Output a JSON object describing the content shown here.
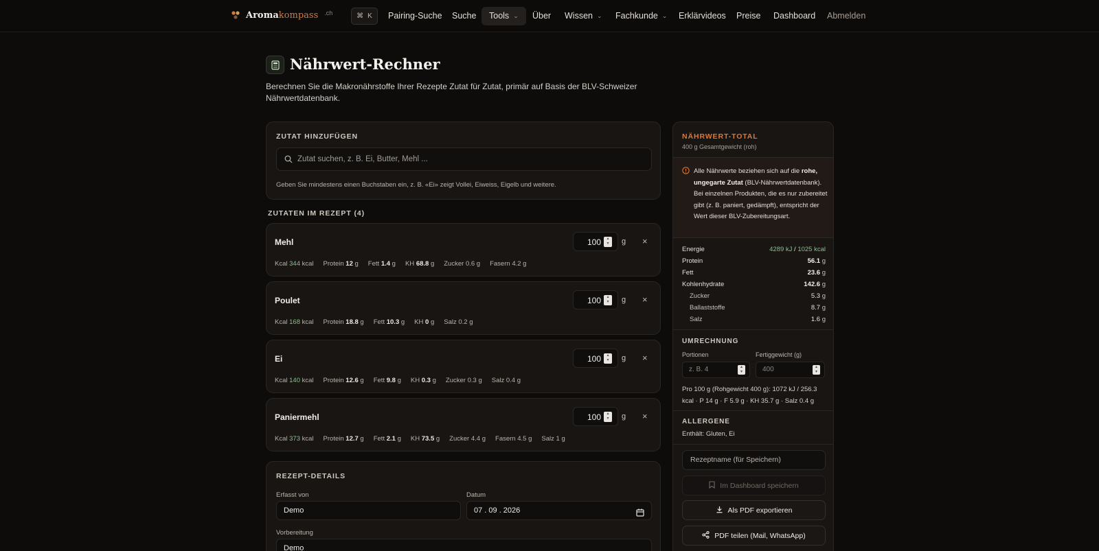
{
  "nav": {
    "logo_main": "Aroma",
    "logo_accent": "kompass",
    "logo_suffix": ".ch",
    "cmd_key": "⌘",
    "cmd_letter": "K",
    "items": [
      {
        "label": "Pairing-Suche"
      },
      {
        "label": "Suche"
      },
      {
        "label": "Tools",
        "active": true
      },
      {
        "label": "Über"
      },
      {
        "label": "Wissen"
      },
      {
        "label": "Fachkunde"
      },
      {
        "label": "Erklärvideos"
      },
      {
        "label": "Preise"
      },
      {
        "label": "Dashboard"
      },
      {
        "label": "Abmelden"
      }
    ]
  },
  "page": {
    "title": "Nährwert-Rechner",
    "subtitle": "Berechnen Sie die Makronährstoffe Ihrer Rezepte Zutat für Zutat, primär auf Basis der BLV-Schweizer Nährwertdatenbank."
  },
  "add": {
    "label": "ZUTAT HINZUFÜGEN",
    "placeholder": "Zutat suchen, z. B. Ei, Butter, Mehl ...",
    "hint": "Geben Sie mindestens einen Buchstaben ein, z. B. «Ei» zeigt Vollei, Eiweiss, Eigelb und weitere."
  },
  "recipe": {
    "heading": "ZUTATEN IM REZEPT (4)",
    "unit": "g",
    "remove": "×",
    "ingredients": [
      {
        "name": "Mehl",
        "qty": "100",
        "macros": [
          {
            "k": "Kcal",
            "v": "344",
            "u": "kcal",
            "kcal": true
          },
          {
            "k": "Protein",
            "v": "12",
            "u": "g"
          },
          {
            "k": "Fett",
            "v": "1.4",
            "u": "g"
          },
          {
            "k": "KH",
            "v": "68.8",
            "u": "g"
          },
          {
            "k": "Zucker",
            "v": "0.6",
            "u": "g",
            "plain": true
          },
          {
            "k": "Fasern",
            "v": "4.2",
            "u": "g",
            "plain": true
          }
        ]
      },
      {
        "name": "Poulet",
        "qty": "100",
        "macros": [
          {
            "k": "Kcal",
            "v": "168",
            "u": "kcal",
            "kcal": true
          },
          {
            "k": "Protein",
            "v": "18.8",
            "u": "g"
          },
          {
            "k": "Fett",
            "v": "10.3",
            "u": "g"
          },
          {
            "k": "KH",
            "v": "0",
            "u": "g"
          },
          {
            "k": "Salz",
            "v": "0.2",
            "u": "g",
            "plain": true
          }
        ]
      },
      {
        "name": "Ei",
        "qty": "100",
        "macros": [
          {
            "k": "Kcal",
            "v": "140",
            "u": "kcal",
            "kcal": true
          },
          {
            "k": "Protein",
            "v": "12.6",
            "u": "g"
          },
          {
            "k": "Fett",
            "v": "9.8",
            "u": "g"
          },
          {
            "k": "KH",
            "v": "0.3",
            "u": "g"
          },
          {
            "k": "Zucker",
            "v": "0.3",
            "u": "g",
            "plain": true
          },
          {
            "k": "Salz",
            "v": "0.4",
            "u": "g",
            "plain": true
          }
        ]
      },
      {
        "name": "Paniermehl",
        "qty": "100",
        "macros": [
          {
            "k": "Kcal",
            "v": "373",
            "u": "kcal",
            "kcal": true
          },
          {
            "k": "Protein",
            "v": "12.7",
            "u": "g"
          },
          {
            "k": "Fett",
            "v": "2.1",
            "u": "g"
          },
          {
            "k": "KH",
            "v": "73.5",
            "u": "g"
          },
          {
            "k": "Zucker",
            "v": "4.4",
            "u": "g",
            "plain": true
          },
          {
            "k": "Fasern",
            "v": "4.5",
            "u": "g",
            "plain": true
          },
          {
            "k": "Salz",
            "v": "1",
            "u": "g",
            "plain": true
          }
        ]
      }
    ]
  },
  "details": {
    "label": "REZEPT-DETAILS",
    "author_label": "Erfasst von",
    "author": "Demo",
    "date_label": "Datum",
    "date": "07 . 09 . 2026",
    "prep_label": "Vorbereitung",
    "prep": "Demo"
  },
  "totals": {
    "title": "NÄHRWERT-TOTAL",
    "subtitle": "400 g Gesamtgewicht (roh)",
    "warning_pre": "Alle Nährwerte beziehen sich auf die ",
    "warning_bold": "rohe, ungegarte Zutat",
    "warning_post": " (BLV-Nährwertdatenbank). Bei einzelnen Produkten, die es nur zubereitet gibt (z. B. paniert, gedämpft), entspricht der Wert dieser BLV-Zubereitungsart.",
    "energy_label": "Energie",
    "energy_kj": "4289 kJ",
    "energy_sep": " / ",
    "energy_kcal": "1025 kcal",
    "rows": [
      {
        "label": "Protein",
        "value": "56.1",
        "unit": "g",
        "bold": true
      },
      {
        "label": "Fett",
        "value": "23.6",
        "unit": "g",
        "bold": true
      },
      {
        "label": "Kohlenhydrate",
        "value": "142.6",
        "unit": "g",
        "bold": true
      },
      {
        "label": "Zucker",
        "value": "5.3",
        "unit": "g",
        "sub": true
      },
      {
        "label": "Ballaststoffe",
        "value": "8.7",
        "unit": "g",
        "sub": true
      },
      {
        "label": "Salz",
        "value": "1.6",
        "unit": "g",
        "sub": true
      }
    ]
  },
  "conversion": {
    "label": "UMRECHNUNG",
    "portions_label": "Portionen",
    "portions_placeholder": "z. B. 4",
    "weight_label": "Fertiggewicht (g)",
    "weight_placeholder": "400",
    "per100": "Pro 100 g (Rohgewicht 400 g): 1072 kJ / 256.3 kcal · P 14 g · F 5.9 g · KH 35.7 g · Salz 0.4 g"
  },
  "allergens": {
    "label": "ALLERGENE",
    "text": "Enthält: Gluten, Ei"
  },
  "actions": {
    "name_placeholder": "Rezeptname (für Speichern)",
    "save": "Im Dashboard speichern",
    "pdf": "Als PDF exportieren",
    "share": "PDF teilen (Mail, WhatsApp)"
  },
  "colors": {
    "background": "#0e0c0b",
    "card": "#181513",
    "accent": "#d9793b",
    "kcal_green": "#8fbf90"
  }
}
